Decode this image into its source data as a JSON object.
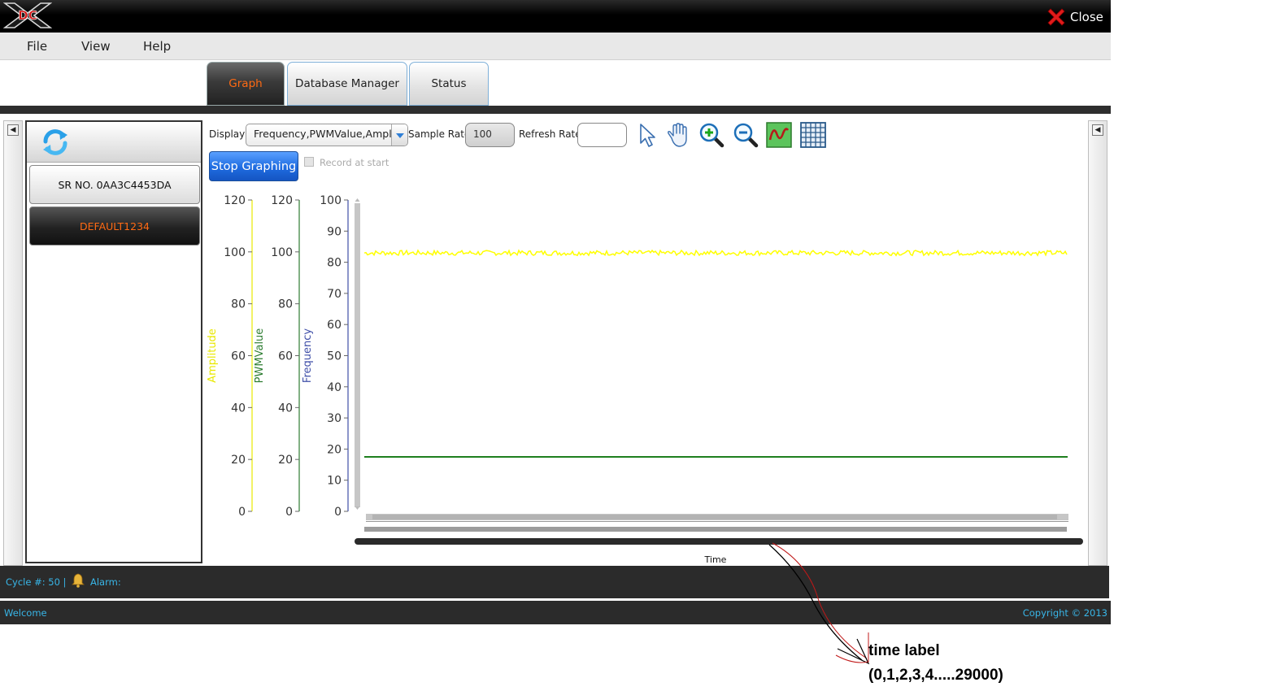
{
  "window": {
    "logo_text": "DC",
    "close_label": "Close"
  },
  "menu": {
    "items": [
      "File",
      "View",
      "Help"
    ]
  },
  "tabs": [
    {
      "label": "Graph",
      "active": true
    },
    {
      "label": "Database Manager",
      "active": false
    },
    {
      "label": "Status",
      "active": false
    }
  ],
  "left_panel": {
    "refresh_icon": "refresh-icon",
    "devices": [
      {
        "label": "SR NO. 0AA3C4453DA",
        "selected": false
      },
      {
        "label": "DEFAULT1234",
        "selected": true
      }
    ]
  },
  "toolbar": {
    "display_label": "Display",
    "display_value": "Frequency,PWMValue,Amplitude",
    "sample_rate_label": "Sample Rate",
    "sample_rate_value": "100",
    "refresh_rate_label": "Refresh Rate",
    "refresh_rate_value": "",
    "icons": [
      "pointer-icon",
      "pan-hand-icon",
      "zoom-in-icon",
      "zoom-out-icon",
      "waveform-icon",
      "grid-icon"
    ],
    "stop_label": "Stop Graphing",
    "record_label": "Record at start"
  },
  "chart_data": {
    "type": "line",
    "xlabel": "Time",
    "axes": [
      {
        "label": "Amplitude",
        "color": "#e8e800",
        "range": [
          0,
          120
        ],
        "ticks": [
          0,
          20,
          40,
          60,
          80,
          100,
          120
        ]
      },
      {
        "label": "PWMValue",
        "color": "#2e7d32",
        "range": [
          0,
          120
        ],
        "ticks": [
          0,
          20,
          40,
          60,
          80,
          100,
          120
        ]
      },
      {
        "label": "Frequency",
        "color": "#3f4fa8",
        "range": [
          0,
          100
        ],
        "ticks": [
          0,
          10,
          20,
          30,
          40,
          50,
          60,
          70,
          80,
          90,
          100
        ]
      }
    ],
    "series": [
      {
        "name": "Amplitude",
        "color": "#ffff00",
        "axis": "Frequency",
        "mean": 83,
        "jitter": 0.8,
        "noisy": true
      },
      {
        "name": "PWMValue",
        "color": "#1e7f1e",
        "axis": "Frequency",
        "mean": 17.5,
        "jitter": 0,
        "noisy": false
      }
    ],
    "grid": false
  },
  "status": {
    "cycle_text": "Cycle #: 50 |",
    "alarm_icon": "bell-icon",
    "alarm_label": "Alarm:",
    "welcome": "Welcome",
    "copyright": "Copyright © 2013"
  },
  "annotation": {
    "line1": "time label",
    "line2": "(0,1,2,3,4.....29000)"
  }
}
